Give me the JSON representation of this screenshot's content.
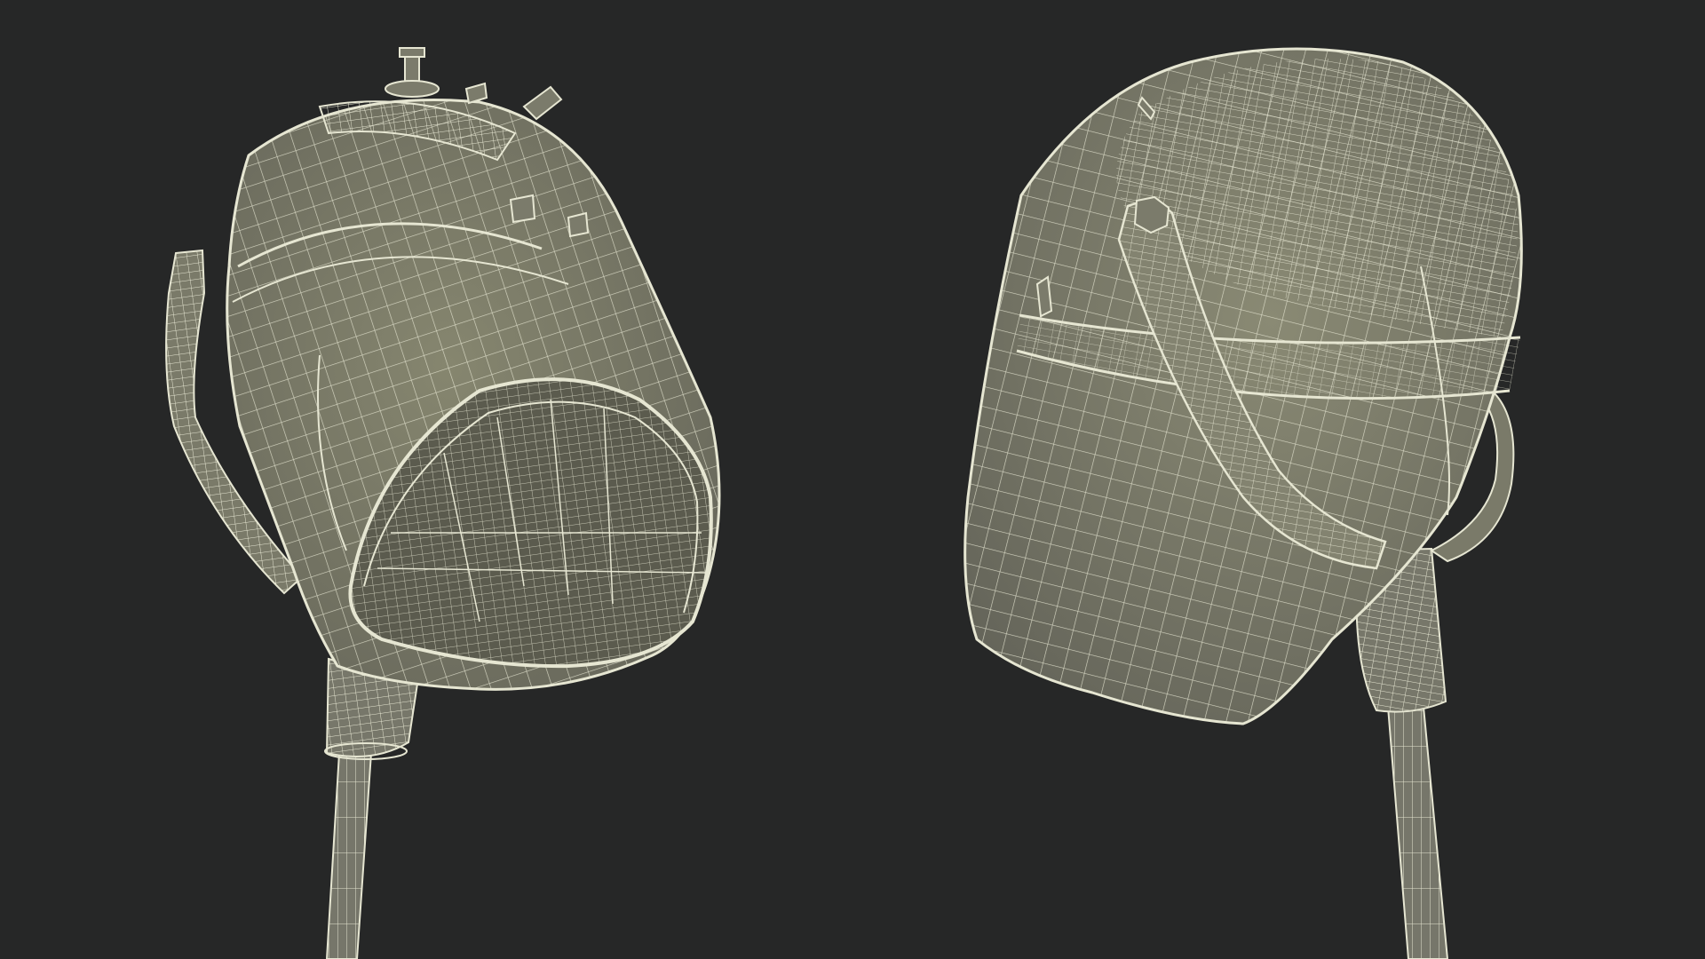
{
  "scene": {
    "background_color": "#262727",
    "shell_color": "#7b7b6b",
    "shell_shadow_color": "#5f5f52",
    "wire_color": "#e6e6d2",
    "objects": [
      {
        "name": "hood-dryer-front-view"
      },
      {
        "name": "hood-dryer-back-view"
      }
    ]
  }
}
